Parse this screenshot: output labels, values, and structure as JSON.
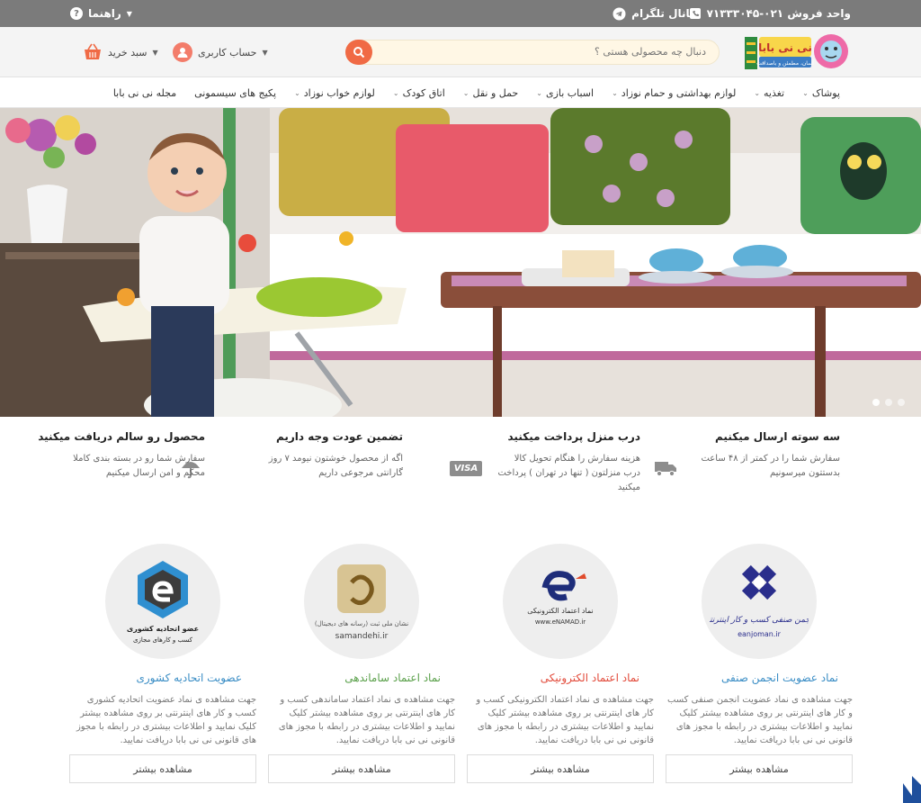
{
  "topbar": {
    "phone_label": "واحد فروش ۰۲۱-۷۱۳۳۳۰۴۵",
    "telegram_label": "کانال تلگرام",
    "help_label": "راهنما"
  },
  "header": {
    "logo_text": "نی نی بابا",
    "logo_sub": "آسان، مطمئن و باصداقت",
    "search_placeholder": "دنبال چه محصولی هستی ؟",
    "account_label": "حساب کاربری",
    "cart_label": "سبد خرید"
  },
  "nav": {
    "items": [
      {
        "label": "پوشاک",
        "dropdown": true
      },
      {
        "label": "تغذیه",
        "dropdown": true
      },
      {
        "label": "لوازم بهداشتی و حمام نوزاد",
        "dropdown": true
      },
      {
        "label": "اسباب بازی",
        "dropdown": true
      },
      {
        "label": "حمل و نقل",
        "dropdown": true
      },
      {
        "label": "اتاق کودک",
        "dropdown": true
      },
      {
        "label": "لوازم خواب نوزاد",
        "dropdown": true
      },
      {
        "label": "پکیج های سیسمونی",
        "dropdown": false
      },
      {
        "label": "مجله نی نی بابا",
        "dropdown": false
      }
    ]
  },
  "hero": {
    "slide_count": 3,
    "active_slide": 3
  },
  "features": [
    {
      "title": "سه سوته ارسال میکنیم",
      "desc": "سفارش شما را در کمتر از ۴۸ ساعت بدستتون میرسونیم",
      "icon": "truck-icon"
    },
    {
      "title": "درب منزل پرداخت میکنید",
      "desc": "هزینه سفارش را هنگام تحویل کالا درب منزلتون ( تنها در تهران ) پرداخت میکنید",
      "icon": "visa-icon",
      "icon_text": "VISA"
    },
    {
      "title": "تضمین عودت وجه داریم",
      "desc": "اگه از محصول خوشتون نیومد ۷ روز گارانتی مرجوعی داریم",
      "icon": "umbrella-icon"
    },
    {
      "title": "محصول رو سالم دریافت میکنید",
      "desc": "سفارش شما رو در بسته بندی کاملا محکم و امن ارسال میکنیم",
      "icon": "diamond-icon"
    }
  ],
  "cards": [
    {
      "title": "نماد عضویت انجمن صنفی",
      "title_color": "#3a8dc5",
      "desc": "جهت مشاهده ی نماد عضویت انجمن صنفی کسب و کار های اینترنتی بر روی مشاهده بیشتر کلیک نمایید و اطلاعات بیشتری در رابطه با مجوز های قانونی نی نی بابا دریافت نمایید.",
      "button": "مشاهده بیشتر",
      "logo_caption": "انجمن صنفی کسب و کار اینترنتی",
      "logo_url": "eanjoman.ir"
    },
    {
      "title": "نماد اعتماد الکترونیکی",
      "title_color": "#e24a3a",
      "desc": "جهت مشاهده ی نماد اعتماد الکترونیکی کسب و کار های اینترنتی بر روی مشاهده بیشتر کلیک نمایید و اطلاعات بیشتری در رابطه با مجوز های قانونی نی نی بابا دریافت نمایید.",
      "button": "مشاهده بیشتر",
      "logo_caption": "نماد اعتماد الکترونیکی",
      "logo_url": "www.eNAMAD.ir"
    },
    {
      "title": "نماد اعتماد ساماندهی",
      "title_color": "#5aa04a",
      "desc": "جهت مشاهده ی نماد اعتماد ساماندهی کسب و کار های اینترنتی بر روی مشاهده بیشتر کلیک نمایید و اطلاعات بیشتری در رابطه با مجوز های قانونی نی نی بابا دریافت نمایید.",
      "button": "مشاهده بیشتر",
      "logo_caption": "نشان ملی ثبت (رسانه های دیجیتال)",
      "logo_url": "samandehi.ir"
    },
    {
      "title": "عضویت اتحادیه کشوری",
      "title_color": "#3a8dc5",
      "desc": "جهت مشاهده ی نماد عضویت اتحادیه کشوری کسب و کار های اینترنتی بر روی مشاهده بیشتر کلیک نمایید و اطلاعات بیشتری در رابطه با مجوز های قانونی نی نی بابا دریافت نمایید.",
      "button": "مشاهده بیشتر",
      "logo_caption": "عضو اتحادیه کشوری",
      "logo_url": "کسب و کارهای مجازی"
    }
  ],
  "colors": {
    "topbar_bg": "#7b7b7b",
    "accent": "#f06a45",
    "search_bg": "#fff7e5"
  }
}
